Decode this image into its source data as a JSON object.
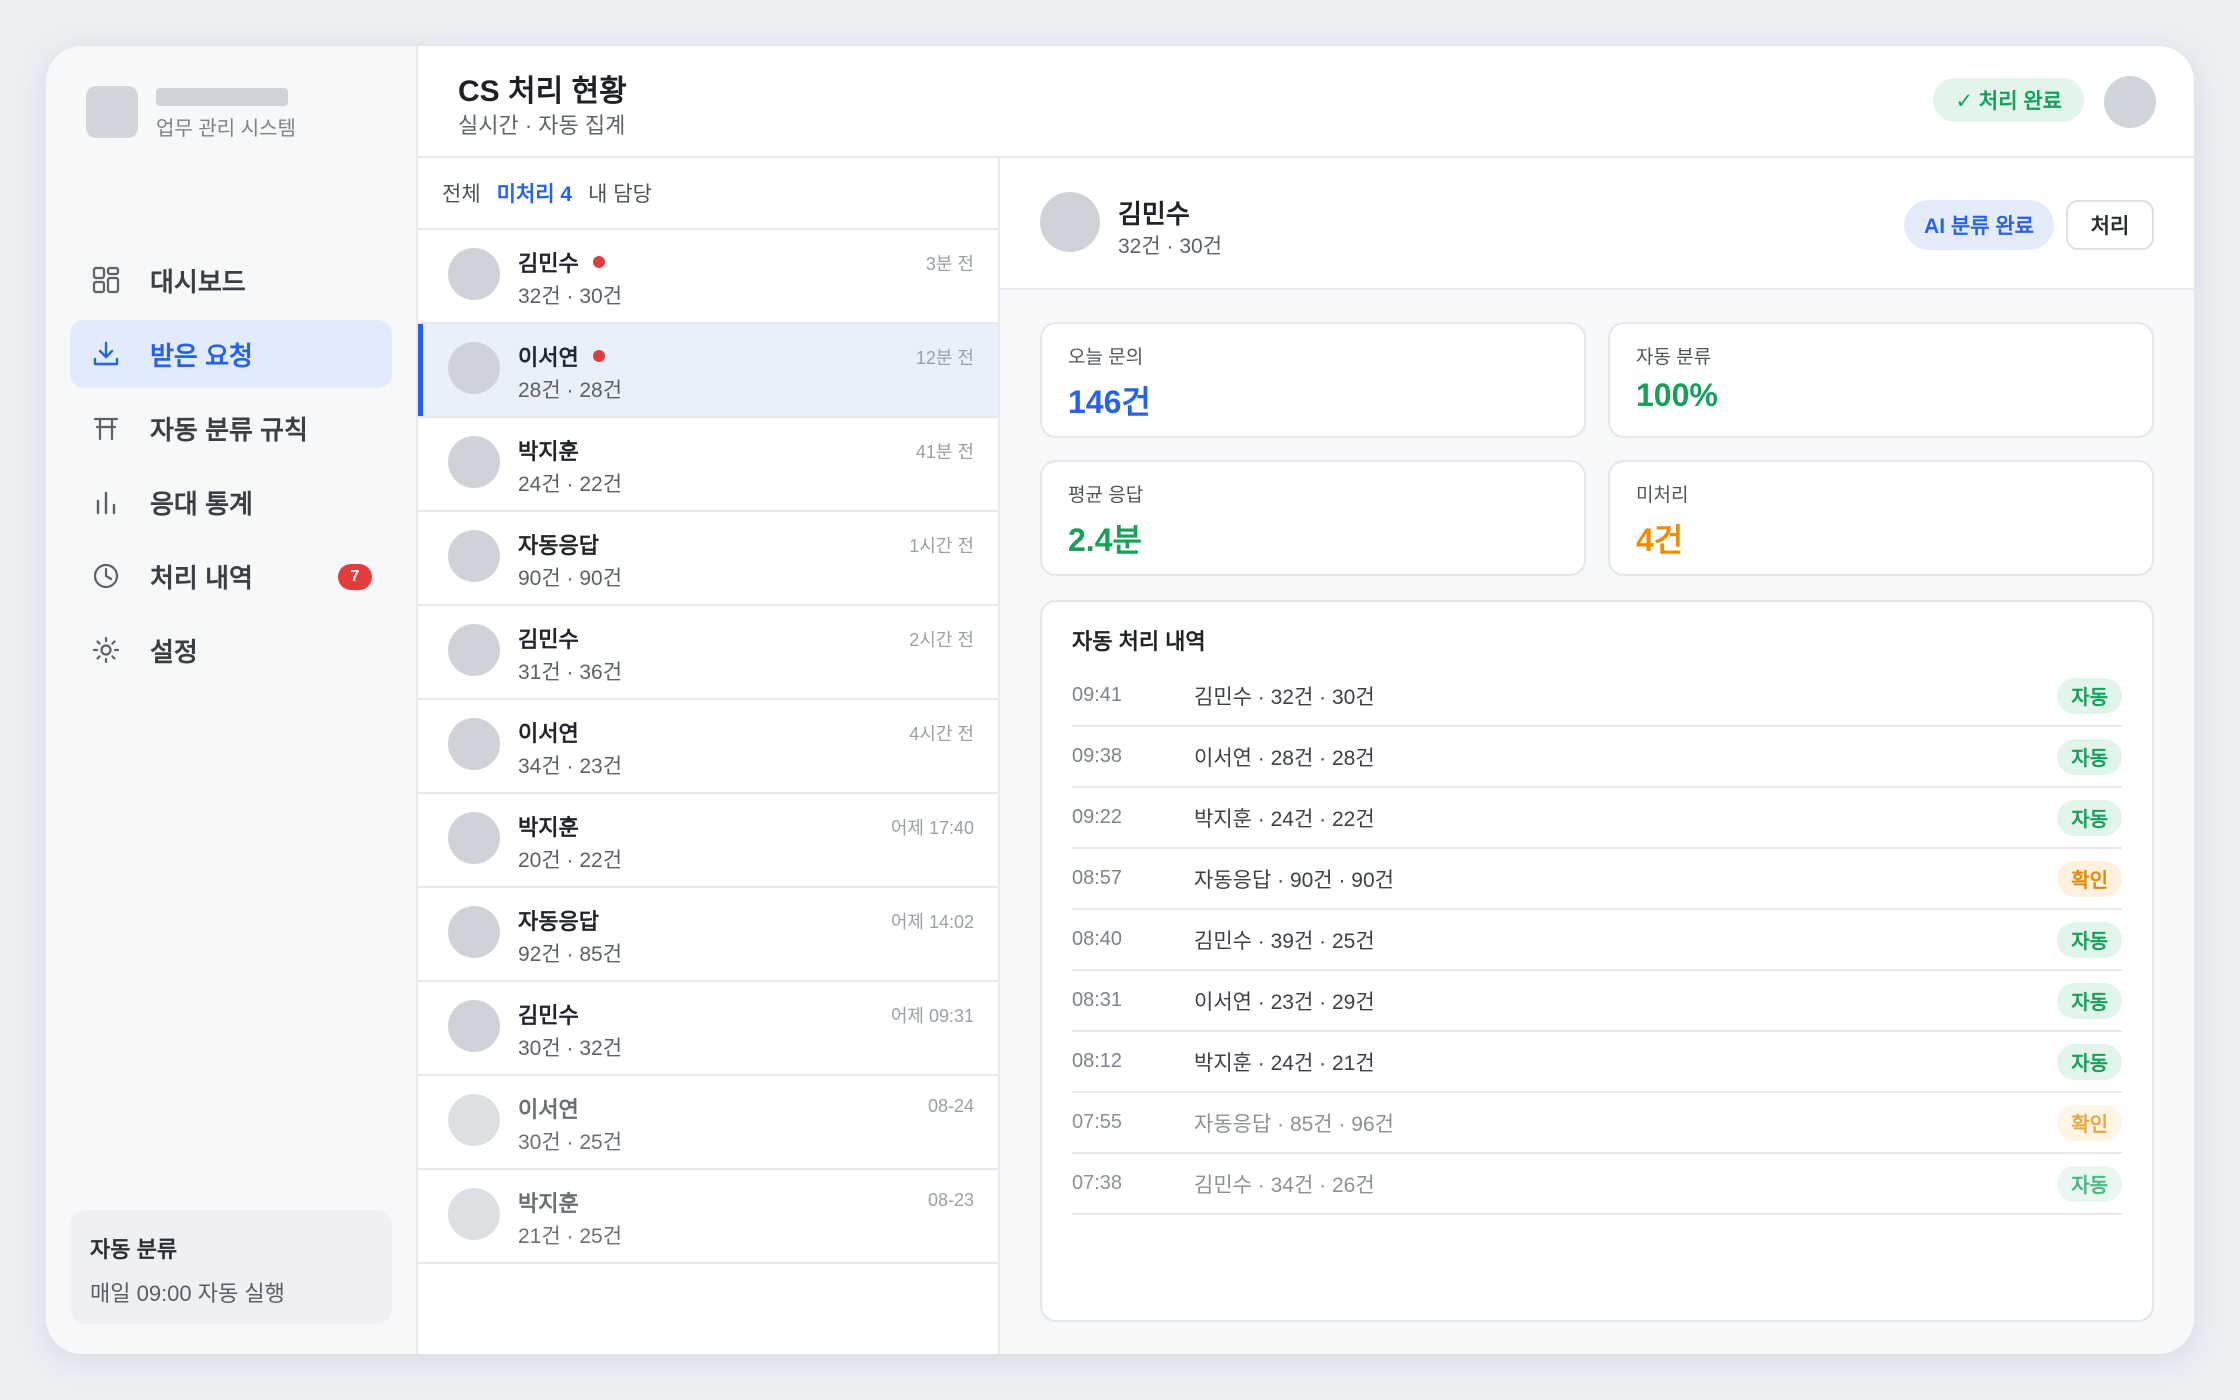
{
  "brand": {
    "subtitle": "업무 관리 시스템"
  },
  "sidebar": {
    "items": [
      {
        "label": "대시보드",
        "icon": "dashboard-icon",
        "active": false
      },
      {
        "label": "받은 요청",
        "icon": "inbox-download-icon",
        "active": true
      },
      {
        "label": "자동 분류 규칙",
        "icon": "rules-table-icon",
        "active": false
      },
      {
        "label": "응대 통계",
        "icon": "bar-chart-icon",
        "active": false
      },
      {
        "label": "처리 내역",
        "icon": "clock-icon",
        "active": false,
        "badge": "7"
      },
      {
        "label": "설정",
        "icon": "gear-icon",
        "active": false
      }
    ],
    "auto_card": {
      "title": "자동 분류",
      "subtitle": "매일 09:00 자동 실행"
    }
  },
  "header": {
    "title": "CS 처리 현황",
    "subtitle": "실시간 · 자동 집계",
    "status": "✓ 처리 완료"
  },
  "filters": {
    "tabs": [
      {
        "label": "전체",
        "active": false
      },
      {
        "label": "미처리 4",
        "active": true
      },
      {
        "label": "내 담당",
        "active": false
      }
    ]
  },
  "list": [
    {
      "name": "김민수",
      "meta": "32건 · 30건",
      "time": "3분 전",
      "unread": true
    },
    {
      "name": "이서연",
      "meta": "28건 · 28건",
      "time": "12분 전",
      "unread": true,
      "selected": true
    },
    {
      "name": "박지훈",
      "meta": "24건 · 22건",
      "time": "41분 전"
    },
    {
      "name": "자동응답",
      "meta": "90건 · 90건",
      "time": "1시간 전"
    },
    {
      "name": "김민수",
      "meta": "31건 · 36건",
      "time": "2시간 전"
    },
    {
      "name": "이서연",
      "meta": "34건 · 23건",
      "time": "4시간 전"
    },
    {
      "name": "박지훈",
      "meta": "20건 · 22건",
      "time": "어제 17:40"
    },
    {
      "name": "자동응답",
      "meta": "92건 · 85건",
      "time": "어제 14:02"
    },
    {
      "name": "김민수",
      "meta": "30건 · 32건",
      "time": "어제 09:31"
    },
    {
      "name": "이서연",
      "meta": "30건 · 25건",
      "time": "08-24",
      "faded": true
    },
    {
      "name": "박지훈",
      "meta": "21건 · 25건",
      "time": "08-23",
      "faded": true
    }
  ],
  "detail": {
    "name": "김민수",
    "meta": "32건 · 30건",
    "ai_badge": "AI 분류 완료",
    "action_label": "처리",
    "stats": [
      {
        "label": "오늘 문의",
        "value": "146건",
        "color": "#2563eb"
      },
      {
        "label": "자동 분류",
        "value": "100%",
        "color": "#16a05a"
      },
      {
        "label": "평균 응답",
        "value": "2.4분",
        "color": "#16a05a"
      },
      {
        "label": "미처리",
        "value": "4건",
        "color": "#f08c00"
      }
    ],
    "log": {
      "title": "자동 처리 내역",
      "rows": [
        {
          "time": "09:41",
          "text": "김민수 · 32건 · 30건",
          "tag": "자동",
          "kind": "auto"
        },
        {
          "time": "09:38",
          "text": "이서연 · 28건 · 28건",
          "tag": "자동",
          "kind": "auto"
        },
        {
          "time": "09:22",
          "text": "박지훈 · 24건 · 22건",
          "tag": "자동",
          "kind": "auto"
        },
        {
          "time": "08:57",
          "text": "자동응답 · 90건 · 90건",
          "tag": "확인",
          "kind": "check"
        },
        {
          "time": "08:40",
          "text": "김민수 · 39건 · 25건",
          "tag": "자동",
          "kind": "auto"
        },
        {
          "time": "08:31",
          "text": "이서연 · 23건 · 29건",
          "tag": "자동",
          "kind": "auto"
        },
        {
          "time": "08:12",
          "text": "박지훈 · 24건 · 21건",
          "tag": "자동",
          "kind": "auto"
        },
        {
          "time": "07:55",
          "text": "자동응답 · 85건 · 96건",
          "tag": "확인",
          "kind": "check",
          "faded": true
        },
        {
          "time": "07:38",
          "text": "김민수 · 34건 · 26건",
          "tag": "자동",
          "kind": "auto",
          "faded": true
        }
      ]
    }
  }
}
